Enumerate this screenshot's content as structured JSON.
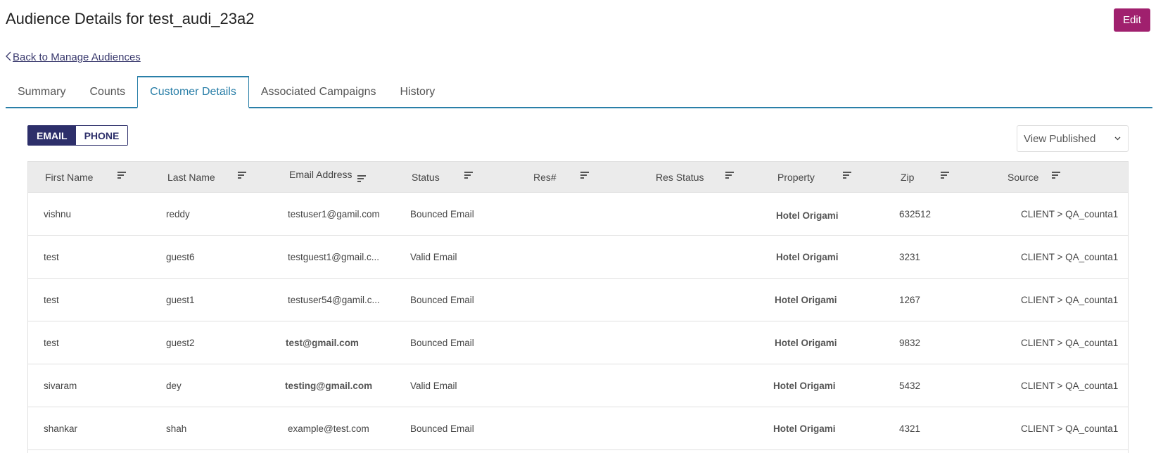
{
  "header": {
    "title": "Audience Details for test_audi_23a2",
    "edit_label": "Edit",
    "back_label": "Back to Manage Audiences"
  },
  "tabs": [
    {
      "label": "Summary",
      "active": false
    },
    {
      "label": "Counts",
      "active": false
    },
    {
      "label": "Customer Details",
      "active": true
    },
    {
      "label": "Associated Campaigns",
      "active": false
    },
    {
      "label": "History",
      "active": false
    }
  ],
  "toggle": {
    "email_label": "EMAIL",
    "phone_label": "PHONE",
    "selected": "EMAIL"
  },
  "view_select": {
    "selected": "View Published"
  },
  "table": {
    "columns": [
      "First Name",
      "Last Name",
      "Email Address",
      "Status",
      "Res#",
      "Res Status",
      "Property",
      "Zip",
      "Source"
    ],
    "rows": [
      {
        "first": "vishnu",
        "last": "reddy",
        "email": "testuser1@gamil.com",
        "status": "Bounced Email",
        "res": "",
        "res_status": "",
        "property": "Hotel Origami",
        "zip": "632512",
        "source": "CLIENT > QA_counta1"
      },
      {
        "first": "test",
        "last": "guest6",
        "email": "testguest1@gmail.c...",
        "status": "Valid Email",
        "res": "",
        "res_status": "",
        "property": "Hotel Origami",
        "zip": "3231",
        "source": "CLIENT > QA_counta1"
      },
      {
        "first": "test",
        "last": "guest1",
        "email": "testuser54@gamil.c...",
        "status": "Bounced Email",
        "res": "",
        "res_status": "",
        "property": "Hotel Origami",
        "zip": "1267",
        "source": "CLIENT > QA_counta1"
      },
      {
        "first": "test",
        "last": "guest2",
        "email": "test@gmail.com",
        "status": "Bounced Email",
        "res": "",
        "res_status": "",
        "property": "Hotel Origami",
        "zip": "9832",
        "source": "CLIENT > QA_counta1"
      },
      {
        "first": "sivaram",
        "last": "dey",
        "email": "testing@gmail.com",
        "status": "Valid Email",
        "res": "",
        "res_status": "",
        "property": "Hotel Origami",
        "zip": "5432",
        "source": "CLIENT > QA_counta1"
      },
      {
        "first": "shankar",
        "last": "shah",
        "email": "example@test.com",
        "status": "Bounced Email",
        "res": "",
        "res_status": "",
        "property": "Hotel Origami",
        "zip": "4321",
        "source": "CLIENT > QA_counta1"
      }
    ]
  },
  "colors": {
    "accent": "#2a7fa8",
    "edit_button": "#a0206e",
    "toggle_active": "#2d2f6a"
  }
}
